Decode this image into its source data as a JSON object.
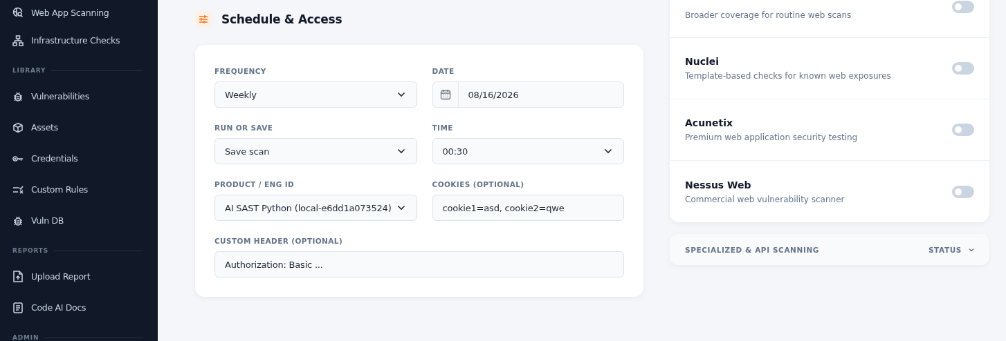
{
  "sidebar": {
    "sections": [
      {
        "items": [
          {
            "label": "Web App Scanning"
          },
          {
            "label": "Infrastructure Checks"
          }
        ]
      },
      {
        "heading": "LIBRARY",
        "items": [
          {
            "label": "Vulnerabilities"
          },
          {
            "label": "Assets"
          },
          {
            "label": "Credentials"
          },
          {
            "label": "Custom Rules"
          },
          {
            "label": "Vuln DB"
          }
        ]
      },
      {
        "heading": "REPORTS",
        "items": [
          {
            "label": "Upload Report"
          },
          {
            "label": "Code AI Docs"
          }
        ]
      },
      {
        "heading": "ADMIN"
      }
    ]
  },
  "schedule": {
    "title": "Schedule & Access",
    "fields": [
      {
        "kind": "select",
        "label": "FREQUENCY",
        "value": "Weekly"
      },
      {
        "kind": "date",
        "label": "DATE",
        "value": "08/16/2026"
      },
      {
        "kind": "select",
        "label": "RUN OR SAVE",
        "value": "Save scan"
      },
      {
        "kind": "select",
        "label": "TIME",
        "value": "00:30"
      },
      {
        "kind": "select",
        "label": "PRODUCT / ENG ID",
        "value": "AI SAST Python (local-e6dd1a073524)"
      },
      {
        "kind": "text",
        "label": "COOKIES (OPTIONAL)",
        "value": "cookie1=asd, cookie2=qwe"
      },
      {
        "kind": "text",
        "label": "CUSTOM HEADER (OPTIONAL)",
        "value": "Authorization: Basic ...",
        "wide": true
      }
    ]
  },
  "scanners": [
    {
      "description": "Broader coverage for routine web scans",
      "on": false
    },
    {
      "name": "Nuclei",
      "description": "Template-based checks for known web exposures",
      "on": false
    },
    {
      "name": "Acunetix",
      "description": "Premium web application security testing",
      "on": false
    },
    {
      "name": "Nessus Web",
      "description": "Commercial web vulnerability scanner",
      "on": false
    }
  ],
  "specialized": {
    "title": "SPECIALIZED & API SCANNING",
    "status": "STATUS"
  }
}
